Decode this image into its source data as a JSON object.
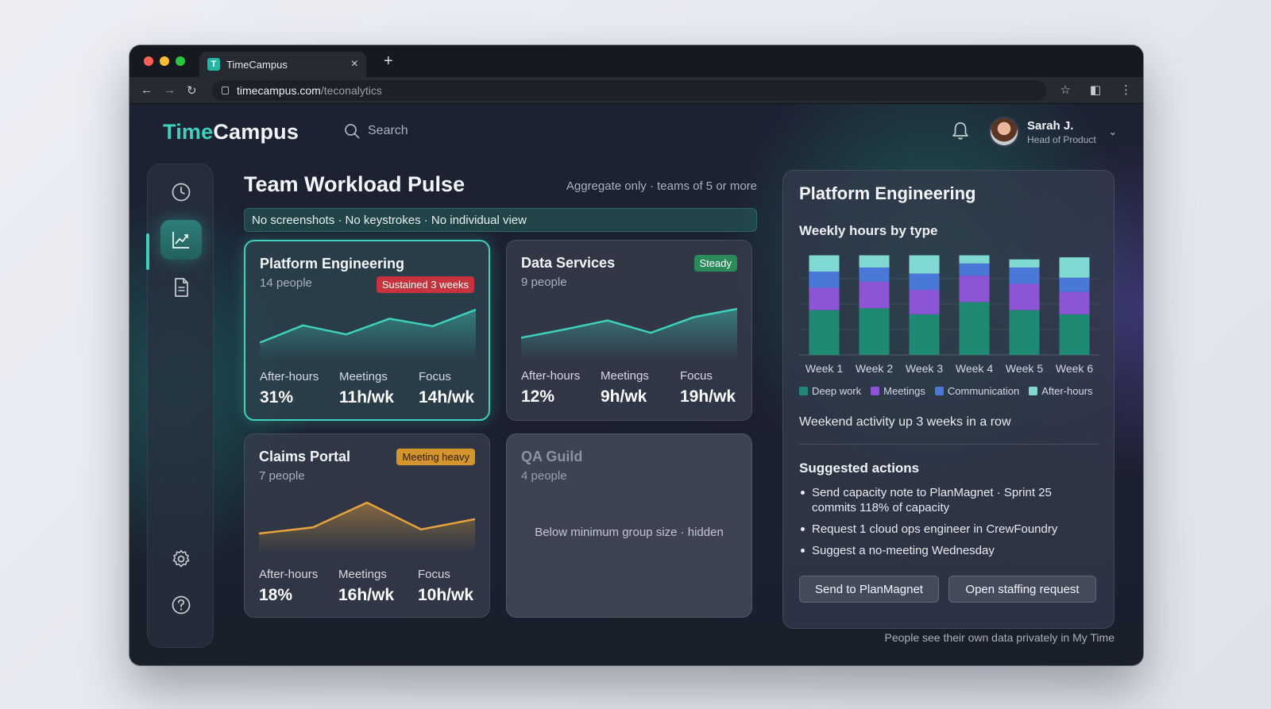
{
  "browser": {
    "tab_title": "TimeCampus",
    "favicon_letter": "T",
    "url_host": "timecampus.com",
    "url_path": "/teconalytics"
  },
  "header": {
    "logo_part1": "Time",
    "logo_part2": "Campus",
    "search_placeholder": "Search",
    "user_name": "Sarah J.",
    "user_role": "Head of Product"
  },
  "main": {
    "title": "Team Workload Pulse",
    "aggregate_note": "Aggregate only · teams of 5 or more",
    "privacy_banner": "No screenshots · No keystrokes · No individual view",
    "metric_labels": {
      "after_hours": "After-hours",
      "meetings": "Meetings",
      "focus": "Focus"
    },
    "teams": [
      {
        "name": "Platform Engineering",
        "people": "14 people",
        "badge": "Sustained 3 weeks",
        "after_hours": "31%",
        "meetings": "11h/wk",
        "focus": "14h/wk",
        "trend": [
          0.2,
          0.62,
          0.4,
          0.78,
          0.6,
          1.0
        ],
        "color": "#3fd0be"
      },
      {
        "name": "Data Services",
        "people": "9 people",
        "badge": "Steady",
        "after_hours": "12%",
        "meetings": "9h/wk",
        "focus": "19h/wk",
        "trend": [
          0.3,
          0.5,
          0.72,
          0.42,
          0.8,
          1.0
        ],
        "color": "#3fd0be"
      },
      {
        "name": "Claims Portal",
        "people": "7 people",
        "badge": "Meeting heavy",
        "after_hours": "18%",
        "meetings": "16h/wk",
        "focus": "10h/wk",
        "trend": [
          0.25,
          0.4,
          1.0,
          0.35,
          0.6
        ],
        "color": "#e8a33a"
      },
      {
        "name": "QA Guild",
        "people": "4 people",
        "note": "Below minimum group size · hidden"
      }
    ]
  },
  "panel": {
    "title": "Platform Engineering",
    "subtitle": "Weekly hours by type",
    "weekend_note": "Weekend activity up 3 weeks in a row",
    "suggested_title": "Suggested actions",
    "actions": [
      "Send capacity note to PlanMagnet · Sprint 25 commits 118% of capacity",
      "Request 1 cloud ops engineer in CrewFoundry",
      "Suggest a no-meeting Wednesday"
    ],
    "button_primary": "Send to PlanMagnet",
    "button_secondary": "Open staffing request"
  },
  "footer_note": "People see their own data privately in My Time",
  "chart_data": {
    "type": "bar",
    "stacked": true,
    "title": "Weekly hours by type",
    "categories": [
      "Week 1",
      "Week 2",
      "Week 3",
      "Week 4",
      "Week 5",
      "Week 6"
    ],
    "series": [
      {
        "name": "Deep work",
        "color": "#1e8a74",
        "values": [
          22,
          23,
          20,
          26,
          22,
          20
        ]
      },
      {
        "name": "Meetings",
        "color": "#8b55d6",
        "values": [
          11,
          13,
          12,
          13,
          13,
          11
        ]
      },
      {
        "name": "Communication",
        "color": "#4a78d8",
        "values": [
          8,
          7,
          8,
          6,
          8,
          7
        ]
      },
      {
        "name": "After-hours",
        "color": "#7fd8d2",
        "values": [
          8,
          6,
          9,
          4,
          4,
          10
        ]
      }
    ],
    "ylim": [
      0,
      50
    ],
    "grid": true,
    "legend": "bottom"
  }
}
